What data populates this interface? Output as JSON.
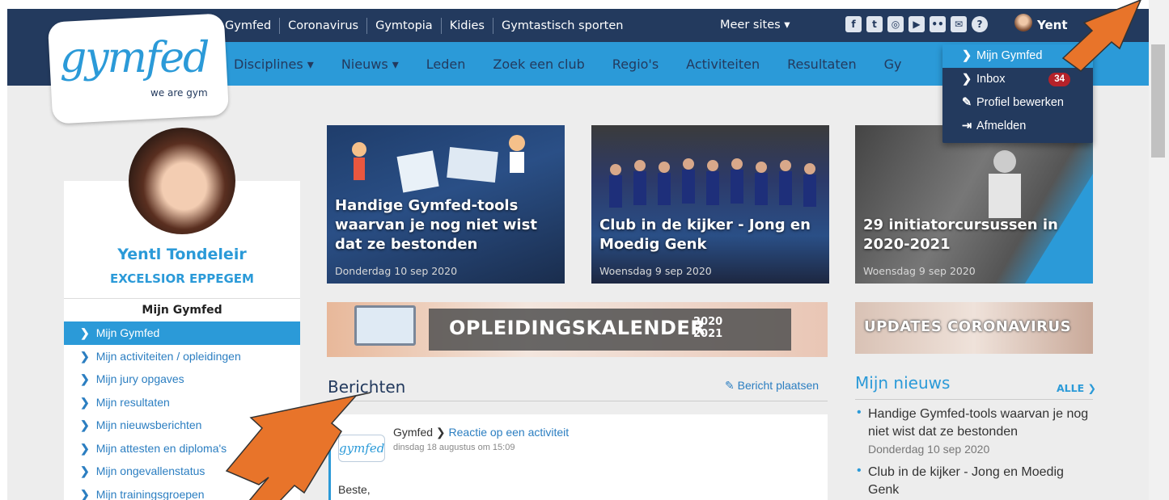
{
  "top_links": [
    "Gymfed",
    "Coronavirus",
    "Gymtopia",
    "Kidies",
    "Gymtastisch sporten"
  ],
  "more_sites": "Meer sites ▾",
  "social_icons": [
    "facebook-icon",
    "twitter-icon",
    "instagram-icon",
    "youtube-icon",
    "flickr-icon",
    "mail-icon",
    "help-icon"
  ],
  "user_short": "Yent",
  "nav": [
    "Disciplines ▾",
    "Nieuws ▾",
    "Leden",
    "Zoek een club",
    "Regio's",
    "Activiteiten",
    "Resultaten",
    "Gy"
  ],
  "logo": {
    "text": "gymfed",
    "tagline": "we are gym"
  },
  "profile": {
    "name": "Yentl Tondeleir",
    "club": "EXCELSIOR EPPEGEM"
  },
  "side_menu": {
    "title": "Mijn Gymfed",
    "items": [
      "Mijn Gymfed",
      "Mijn activiteiten / opleidingen",
      "Mijn jury opgaves",
      "Mijn resultaten",
      "Mijn nieuwsberichten",
      "Mijn attesten en diploma's",
      "Mijn ongevallenstatus",
      "Mijn trainingsgroepen"
    ]
  },
  "tiles": [
    {
      "title": "Handige Gymfed-tools waarvan je nog niet wist dat ze bestonden",
      "date": "Donderdag 10 sep 2020"
    },
    {
      "title": "Club in de kijker - Jong en Moedig Genk",
      "date": "Woensdag 9 sep 2020"
    },
    {
      "title": "29 initiatorcursussen in 2020-2021",
      "date": "Woensdag 9 sep 2020"
    }
  ],
  "banners": {
    "opleiding": "OPLEIDINGSKALENDER",
    "opleiding_year_1": "2020",
    "opleiding_year_2": "2021",
    "corona": "UPDATES CORONAVIRUS"
  },
  "berichten": {
    "title": "Berichten",
    "post_link": "Bericht plaatsen",
    "post": {
      "logo": "gymfed",
      "from": "Gymfed",
      "subject": "Reactie op een activiteit",
      "date": "dinsdag 18 augustus om 15:09",
      "body": "Beste,"
    }
  },
  "mijn_nieuws": {
    "title": "Mijn nieuws",
    "all_link": "ALLE",
    "items": [
      {
        "text": "Handige Gymfed-tools waarvan je nog niet wist dat ze bestonden",
        "date": "Donderdag 10 sep 2020"
      },
      {
        "text": "Club in de kijker - Jong en Moedig Genk",
        "date": ""
      }
    ]
  },
  "dropdown": {
    "items": [
      {
        "icon": "chevron-right-icon",
        "label": "Mijn Gymfed"
      },
      {
        "icon": "chevron-right-icon",
        "label": "Inbox",
        "badge": "34"
      },
      {
        "icon": "pencil-icon",
        "label": "Profiel bewerken"
      },
      {
        "icon": "sign-out-icon",
        "label": "Afmelden"
      }
    ]
  },
  "colors": {
    "navy": "#233a5e",
    "blue": "#2b9ad8",
    "badge": "#b5222a",
    "arrow": "#e8742a"
  }
}
